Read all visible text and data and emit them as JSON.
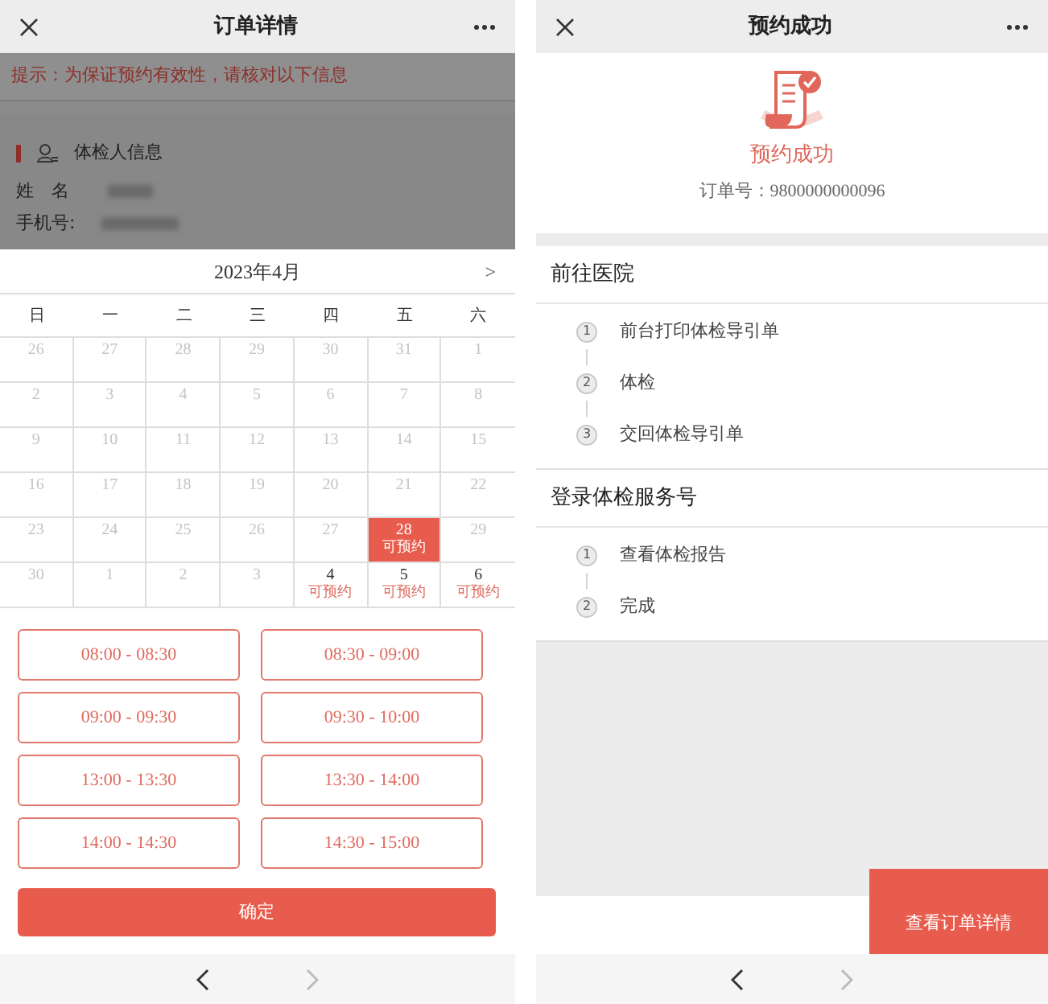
{
  "left_screen": {
    "nav": {
      "title": "订单详情"
    },
    "tip": "提示：为保证预约有效性，请核对以下信息",
    "person_section": {
      "title": "体检人信息",
      "fields": [
        {
          "label": "姓　名"
        },
        {
          "label": "手机号:"
        }
      ]
    },
    "calendar": {
      "month": "2023年4月",
      "next": ">",
      "weekdays": [
        "日",
        "一",
        "二",
        "三",
        "四",
        "五",
        "六"
      ],
      "days": [
        {
          "day": "26",
          "available": false,
          "selected": false
        },
        {
          "day": "27",
          "available": false,
          "selected": false
        },
        {
          "day": "28",
          "available": false,
          "selected": false
        },
        {
          "day": "29",
          "available": false,
          "selected": false
        },
        {
          "day": "30",
          "available": false,
          "selected": false
        },
        {
          "day": "31",
          "available": false,
          "selected": false
        },
        {
          "day": "1",
          "available": false,
          "selected": false
        },
        {
          "day": "2",
          "available": false,
          "selected": false
        },
        {
          "day": "3",
          "available": false,
          "selected": false
        },
        {
          "day": "4",
          "available": false,
          "selected": false
        },
        {
          "day": "5",
          "available": false,
          "selected": false
        },
        {
          "day": "6",
          "available": false,
          "selected": false
        },
        {
          "day": "7",
          "available": false,
          "selected": false
        },
        {
          "day": "8",
          "available": false,
          "selected": false
        },
        {
          "day": "9",
          "available": false,
          "selected": false
        },
        {
          "day": "10",
          "available": false,
          "selected": false
        },
        {
          "day": "11",
          "available": false,
          "selected": false
        },
        {
          "day": "12",
          "available": false,
          "selected": false
        },
        {
          "day": "13",
          "available": false,
          "selected": false
        },
        {
          "day": "14",
          "available": false,
          "selected": false
        },
        {
          "day": "15",
          "available": false,
          "selected": false
        },
        {
          "day": "16",
          "available": false,
          "selected": false
        },
        {
          "day": "17",
          "available": false,
          "selected": false
        },
        {
          "day": "18",
          "available": false,
          "selected": false
        },
        {
          "day": "19",
          "available": false,
          "selected": false
        },
        {
          "day": "20",
          "available": false,
          "selected": false
        },
        {
          "day": "21",
          "available": false,
          "selected": false
        },
        {
          "day": "22",
          "available": false,
          "selected": false
        },
        {
          "day": "23",
          "available": false,
          "selected": false
        },
        {
          "day": "24",
          "available": false,
          "selected": false
        },
        {
          "day": "25",
          "available": false,
          "selected": false
        },
        {
          "day": "26",
          "available": false,
          "selected": false
        },
        {
          "day": "27",
          "available": false,
          "selected": false
        },
        {
          "day": "28",
          "available": true,
          "selected": true,
          "note": "可预约"
        },
        {
          "day": "29",
          "available": false,
          "selected": false
        },
        {
          "day": "30",
          "available": false,
          "selected": false
        },
        {
          "day": "1",
          "available": false,
          "selected": false
        },
        {
          "day": "2",
          "available": false,
          "selected": false
        },
        {
          "day": "3",
          "available": false,
          "selected": false
        },
        {
          "day": "4",
          "available": true,
          "selected": false,
          "note": "可预约"
        },
        {
          "day": "5",
          "available": true,
          "selected": false,
          "note": "可预约"
        },
        {
          "day": "6",
          "available": true,
          "selected": false,
          "note": "可预约"
        }
      ]
    },
    "time_slots": [
      {
        "label": "08:00 - 08:30",
        "selected": false
      },
      {
        "label": "08:30 - 09:00",
        "selected": false
      },
      {
        "label": "09:00 - 09:30",
        "selected": false
      },
      {
        "label": "09:30 - 10:00",
        "selected": false
      },
      {
        "label": "13:00 - 13:30",
        "selected": false
      },
      {
        "label": "13:30 - 14:00",
        "selected": false
      },
      {
        "label": "14:00 - 14:30",
        "selected": false
      },
      {
        "label": "14:30 - 15:00",
        "selected": false
      }
    ],
    "confirm_button": "确定",
    "browser_bar": {
      "back_enabled": true,
      "forward_enabled": false
    }
  },
  "right_screen": {
    "nav": {
      "title": "预约成功"
    },
    "success": {
      "title": "预约成功",
      "order_label": "订单号：",
      "order_number": "9800000000096"
    },
    "sections": [
      {
        "title": "前往医院",
        "steps": [
          {
            "number": "1",
            "label": "前台打印体检导引单"
          },
          {
            "number": "2",
            "label": "体检"
          },
          {
            "number": "3",
            "label": "交回体检导引单"
          }
        ]
      },
      {
        "title": "登录体检服务号",
        "steps": [
          {
            "number": "1",
            "label": "查看体检报告"
          },
          {
            "number": "2",
            "label": "完成"
          }
        ]
      }
    ],
    "order_button": "查看订单详情",
    "browser_bar": {
      "back_enabled": true,
      "forward_enabled": false
    }
  }
}
